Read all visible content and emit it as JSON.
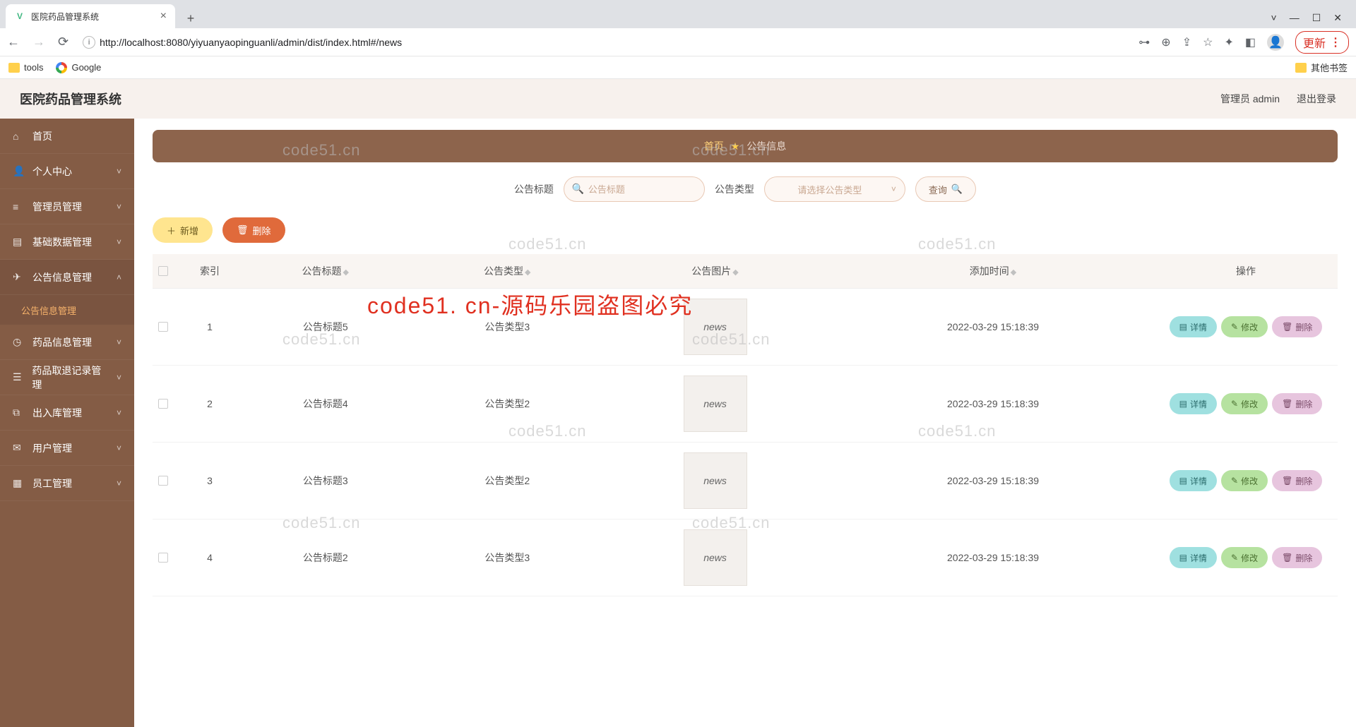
{
  "browser": {
    "tab_title": "医院药品管理系统",
    "url": "http://localhost:8080/yiyuanyaopinguanli/admin/dist/index.html#/news",
    "update": "更新",
    "bookmarks": {
      "tools": "tools",
      "google": "Google",
      "other": "其他书签"
    }
  },
  "app": {
    "title": "医院药品管理系统",
    "user_label": "管理员 admin",
    "logout": "退出登录"
  },
  "sidebar": {
    "items": [
      {
        "label": "首页",
        "icon": "home-icon",
        "chev": false
      },
      {
        "label": "个人中心",
        "icon": "user-icon",
        "chev": true
      },
      {
        "label": "管理员管理",
        "icon": "bars-icon",
        "chev": true
      },
      {
        "label": "基础数据管理",
        "icon": "doc-icon",
        "chev": true
      },
      {
        "label": "公告信息管理",
        "icon": "send-icon",
        "chev": true,
        "open": true
      },
      {
        "label": "药品信息管理",
        "icon": "clock-icon",
        "chev": true
      },
      {
        "label": "药品取退记录管理",
        "icon": "list-icon",
        "chev": true
      },
      {
        "label": "出入库管理",
        "icon": "box-icon",
        "chev": true
      },
      {
        "label": "用户管理",
        "icon": "chat-icon",
        "chev": true
      },
      {
        "label": "员工管理",
        "icon": "grid-icon",
        "chev": true
      }
    ],
    "sub": "公告信息管理"
  },
  "breadcrumb": {
    "home": "首页",
    "current": "公告信息"
  },
  "search": {
    "title_label": "公告标题",
    "title_ph": "公告标题",
    "type_label": "公告类型",
    "type_ph": "请选择公告类型",
    "query": "查询"
  },
  "actions": {
    "add": "新增",
    "del": "删除"
  },
  "table": {
    "headers": {
      "index": "索引",
      "title": "公告标题",
      "type": "公告类型",
      "image": "公告图片",
      "time": "添加时间",
      "op": "操作"
    },
    "row_ops": {
      "detail": "详情",
      "edit": "修改",
      "delete": "删除"
    },
    "rows": [
      {
        "index": "1",
        "title": "公告标题5",
        "type": "公告类型3",
        "time": "2022-03-29 15:18:39"
      },
      {
        "index": "2",
        "title": "公告标题4",
        "type": "公告类型2",
        "time": "2022-03-29 15:18:39"
      },
      {
        "index": "3",
        "title": "公告标题3",
        "type": "公告类型2",
        "time": "2022-03-29 15:18:39"
      },
      {
        "index": "4",
        "title": "公告标题2",
        "type": "公告类型3",
        "time": "2022-03-29 15:18:39"
      }
    ]
  },
  "watermark": {
    "text": "code51.cn",
    "red": "code51. cn-源码乐园盗图必究"
  }
}
